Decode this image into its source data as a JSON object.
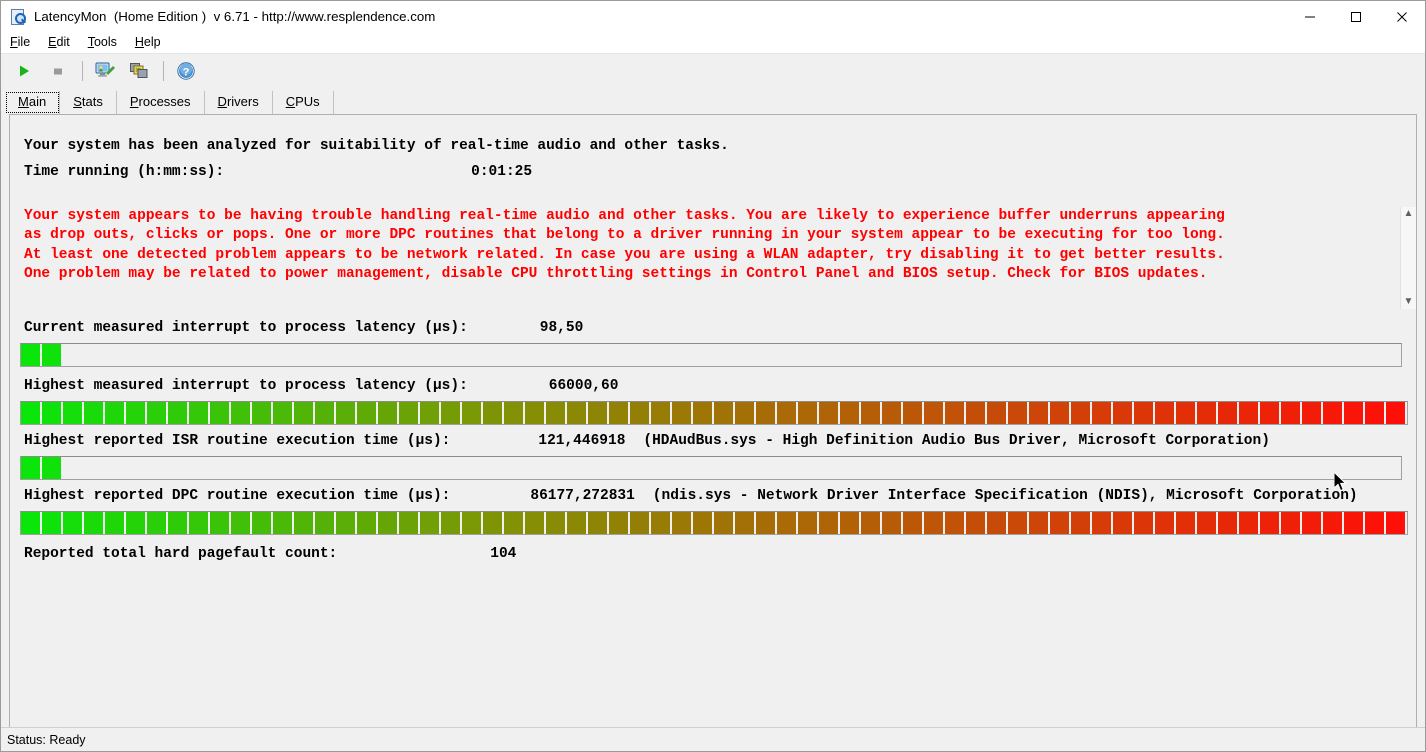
{
  "window": {
    "title": "LatencyMon  (Home Edition )  v 6.71 - http://www.resplendence.com",
    "icon": "magnifier-document-icon",
    "minimize_label": "–",
    "maximize_label": "□",
    "close_label": "✕"
  },
  "menubar": {
    "items": [
      {
        "label": "File",
        "accel": "F"
      },
      {
        "label": "Edit",
        "accel": "E"
      },
      {
        "label": "Tools",
        "accel": "T"
      },
      {
        "label": "Help",
        "accel": "H"
      }
    ]
  },
  "toolbar": {
    "buttons": [
      {
        "name": "start-monitoring-button",
        "icon": "play-icon"
      },
      {
        "name": "stop-monitoring-button",
        "icon": "stop-icon"
      },
      {
        "name": "report-button",
        "icon": "monitor-pencil-icon"
      },
      {
        "name": "copy-button",
        "icon": "stacked-windows-icon"
      },
      {
        "name": "help-button",
        "icon": "question-mark-icon"
      }
    ]
  },
  "tabs": [
    {
      "label": "Main",
      "accel": "M",
      "selected": true
    },
    {
      "label": "Stats",
      "accel": "S",
      "selected": false
    },
    {
      "label": "Processes",
      "accel": "P",
      "selected": false
    },
    {
      "label": "Drivers",
      "accel": "D",
      "selected": false
    },
    {
      "label": "CPUs",
      "accel": "C",
      "selected": false
    }
  ],
  "main": {
    "headline": "Your system has been analyzed for suitability of real-time audio and other tasks.",
    "time_running_label": "Time running (h:mm:ss):",
    "time_running_value": "0:01:25",
    "warning_color": "#ff0000",
    "warning_lines": [
      "Your system appears to be having trouble handling real-time audio and other tasks. You are likely to experience buffer underruns appearing",
      "as drop outs, clicks or pops. One or more DPC routines that belong to a driver running in your system appear to be executing for too long.",
      "At least one detected problem appears to be network related. In case you are using a WLAN adapter, try disabling it to get better results.",
      "One problem may be related to power management, disable CPU throttling settings in Control Panel and BIOS setup. Check for BIOS updates."
    ],
    "metrics": [
      {
        "name": "current-interrupt-latency",
        "label": "Current measured interrupt to process latency (µs):",
        "value": "98,50",
        "detail": "",
        "bar_segments": 2,
        "bar_style": "short"
      },
      {
        "name": "highest-interrupt-latency",
        "label": "Highest measured interrupt to process latency (µs):",
        "value": "66000,60",
        "detail": "",
        "bar_segments": 66,
        "bar_style": "full"
      },
      {
        "name": "highest-isr-execution-time",
        "label": "Highest reported ISR routine execution time (µs):",
        "value": "121,446918",
        "detail": "(HDAudBus.sys - High Definition Audio Bus Driver, Microsoft Corporation)",
        "bar_segments": 2,
        "bar_style": "short"
      },
      {
        "name": "highest-dpc-execution-time",
        "label": "Highest reported DPC routine execution time (µs):",
        "value": "86177,272831",
        "detail": "(ndis.sys - Network Driver Interface Specification (NDIS), Microsoft Corporation)",
        "bar_segments": 66,
        "bar_style": "full"
      }
    ],
    "pagefault_label": "Reported total hard pagefault count:",
    "pagefault_value": "104",
    "scroll_up_icon": "chevron-up-icon",
    "scroll_down_icon": "chevron-down-icon"
  },
  "statusbar": {
    "text": "Status: Ready"
  }
}
